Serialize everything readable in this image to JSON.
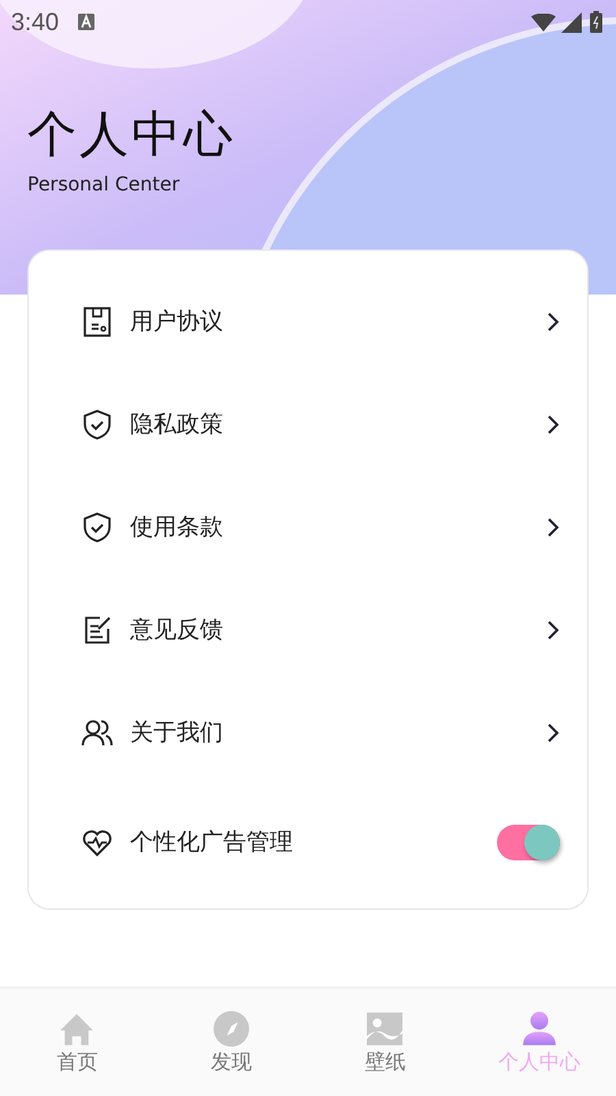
{
  "status_bar": {
    "time": "3:40"
  },
  "header": {
    "title": "个人中心",
    "subtitle": "Personal Center"
  },
  "menu": [
    {
      "kind": "link",
      "label": "用户协议"
    },
    {
      "kind": "link",
      "label": "隐私政策"
    },
    {
      "kind": "link",
      "label": "使用条款"
    },
    {
      "kind": "link",
      "label": "意见反馈"
    },
    {
      "kind": "link",
      "label": "关于我们"
    },
    {
      "kind": "toggle",
      "label": "个性化广告管理",
      "on": true
    }
  ],
  "tab_bar": [
    {
      "label": "首页",
      "selected": false
    },
    {
      "label": "发现",
      "selected": false
    },
    {
      "label": "壁纸",
      "selected": false
    },
    {
      "label": "个人中心",
      "selected": true
    }
  ]
}
